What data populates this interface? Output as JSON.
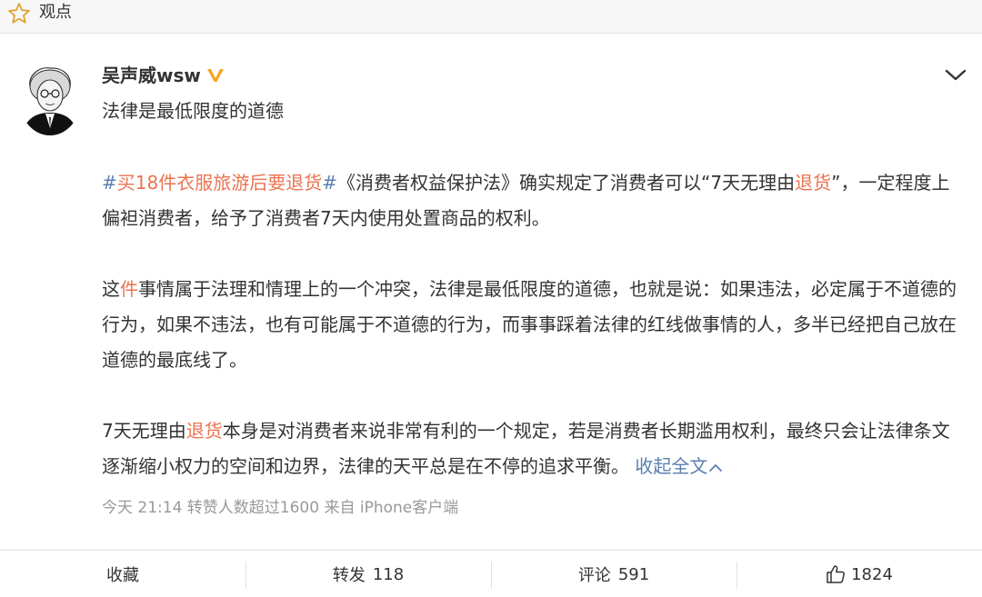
{
  "header": {
    "label": "观点",
    "icon": "star-outline-icon"
  },
  "post": {
    "author": "吴声威wsw",
    "verified_icon": "verified-v-icon",
    "verified_color": "#f5a623",
    "title": "法律是最低限度的道德",
    "p1": {
      "hash_open": "#",
      "tag": "买18件衣服旅游后要退货",
      "hash_close": "#",
      "text_a": "《消费者权益保护法》确实规定了消费者可以“7天无理由",
      "hl": "退货",
      "text_b": "”，一定程度上偏袒消费者，给予了消费者7天内使用处置商品的权利。"
    },
    "p2": {
      "text_a": "这",
      "hl": "件",
      "text_b": "事情属于法理和情理上的一个冲突，法律是最低限度的道德，也就是说：如果违法，必定属于不道德的行为，如果不违法，也有可能属于不道德的行为，而事事踩着法律的红线做事情的人，多半已经把自己放在道德的最底线了。"
    },
    "p3": {
      "text_a": "7天无理由",
      "hl": "退货",
      "text_b": "本身是对消费者来说非常有利的一个规定，若是消费者长期滥用权利，最终只会让法律条文逐渐缩小权力的空间和边界，法律的天平总是在不停的追求平衡。",
      "collapse": "收起全文"
    },
    "meta": "今天 21:14 转赞人数超过1600 来自 iPhone客户端"
  },
  "actions": {
    "favorite": "收藏",
    "repost_label": "转发",
    "repost_count": "118",
    "comment_label": "评论",
    "comment_count": "591",
    "like_count": "1824"
  },
  "colors": {
    "highlight": "#eb7350",
    "link": "#5b7fb1",
    "meta": "#999999"
  }
}
